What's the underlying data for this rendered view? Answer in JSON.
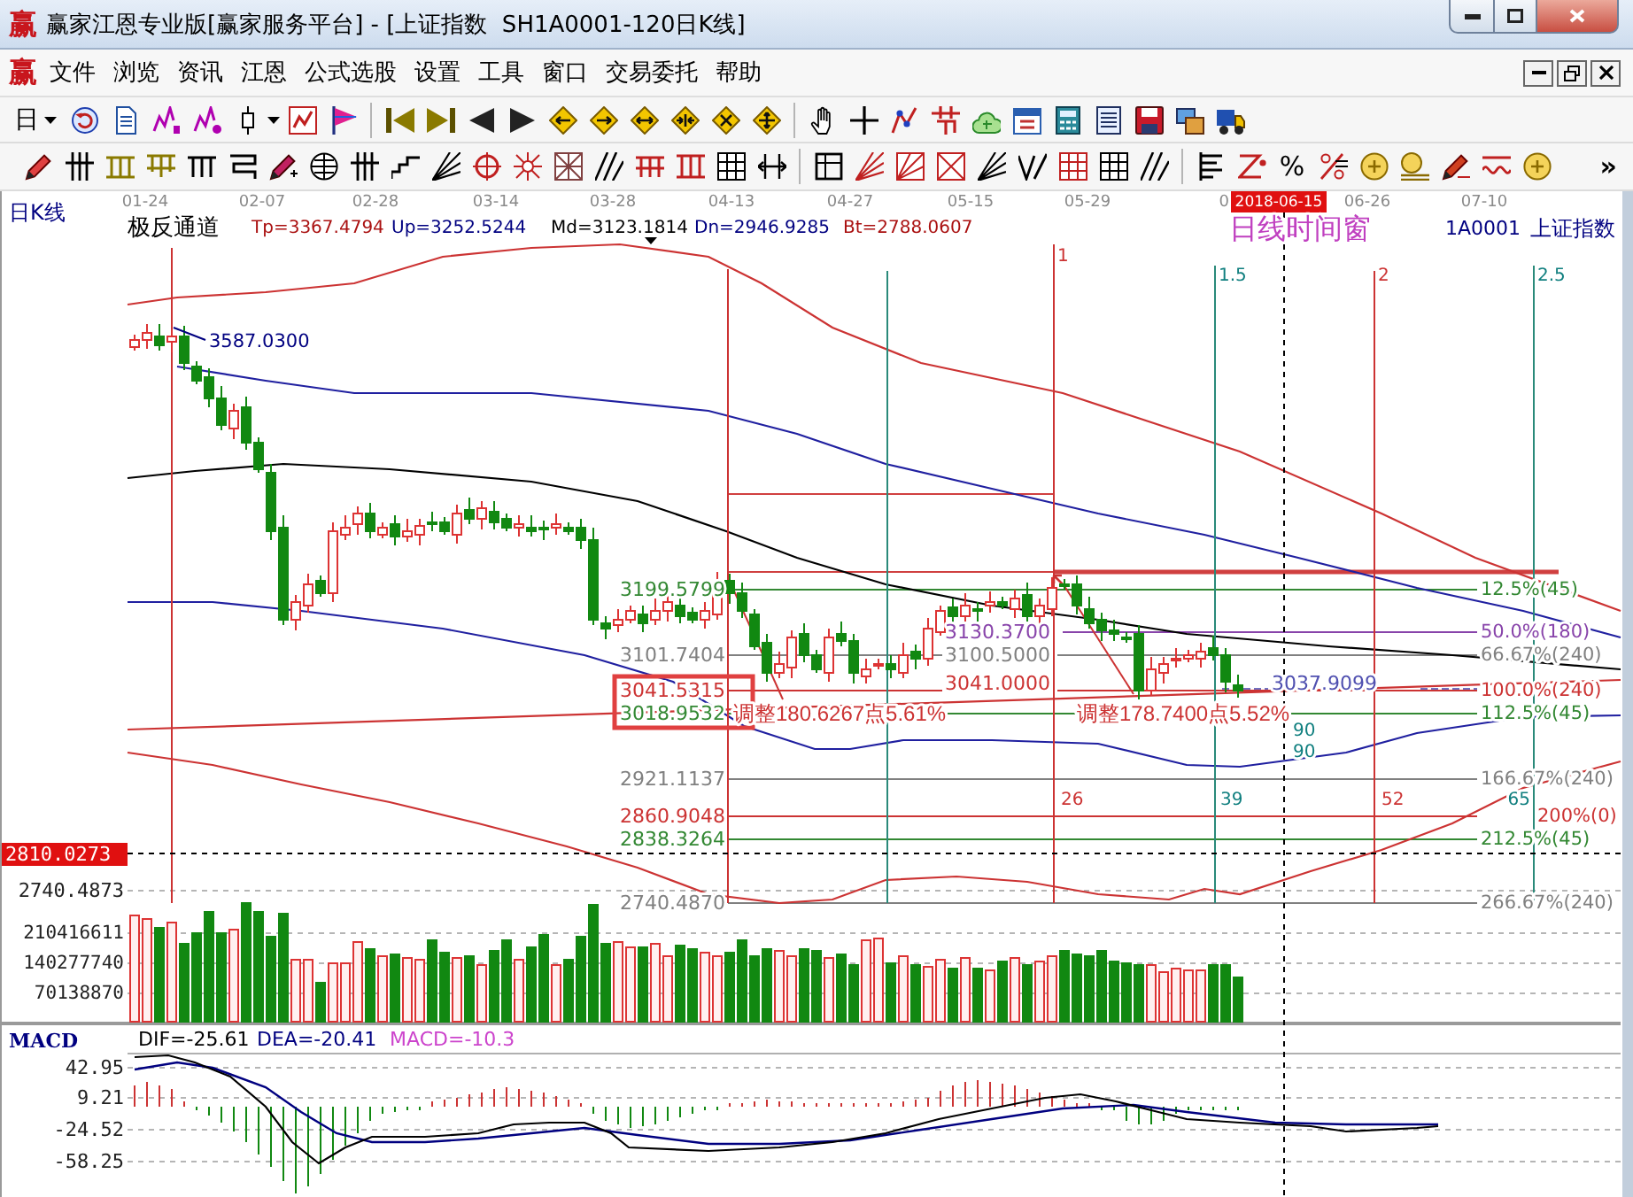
{
  "window": {
    "icon": "赢",
    "title": "赢家江恩专业版[赢家服务平台] - [上证指数  SH1A0001-120日K线]"
  },
  "menu": {
    "icon": "赢",
    "items": [
      "文件",
      "浏览",
      "资讯",
      "江恩",
      "公式选股",
      "设置",
      "工具",
      "窗口",
      "交易委托",
      "帮助"
    ]
  },
  "toolbar": {
    "period": "日",
    "percent": "%",
    "overflow": "»"
  },
  "chart": {
    "period": "日K线",
    "dates": [
      {
        "label": "01-24",
        "kind": "tick"
      },
      {
        "label": "02-07",
        "kind": "tick"
      },
      {
        "label": "02-28",
        "kind": "tick"
      },
      {
        "label": "03-14",
        "kind": "tick"
      },
      {
        "label": "03-28",
        "kind": "tick"
      },
      {
        "label": "04-13",
        "kind": "tick"
      },
      {
        "label": "04-27",
        "kind": "tick"
      },
      {
        "label": "05-15",
        "kind": "tick"
      },
      {
        "label": "05-29",
        "kind": "tick"
      },
      {
        "label": "0",
        "kind": "tick"
      },
      {
        "label": "2018-06-15",
        "kind": "cursor"
      },
      {
        "label": "06-26",
        "kind": "tick"
      },
      {
        "label": "07-10",
        "kind": "tick"
      }
    ],
    "indicator": {
      "name": "极反通道",
      "values": [
        {
          "text": "Tp=3367.4794",
          "color": "#aa1111"
        },
        {
          "text": "Up=3252.5244",
          "color": "#000080"
        },
        {
          "text": "Md=3123.1814",
          "color": "#000000"
        },
        {
          "text": "Dn=2946.9285",
          "color": "#000080"
        },
        {
          "text": "Bt=2788.0607",
          "color": "#aa1111"
        }
      ]
    },
    "window_label": "日线时间窗",
    "code": "1A0001",
    "name": "上证指数",
    "peak_price": "3587.0300",
    "time_marks": [
      {
        "label": "1",
        "color": "#cc3333"
      },
      {
        "label": "1.5",
        "color": "#107f7f"
      },
      {
        "label": "2",
        "color": "#cc3333"
      },
      {
        "label": "2.5",
        "color": "#107f7f"
      }
    ],
    "level_prices": [
      {
        "text": "3199.5799",
        "color": "#338833"
      },
      {
        "text": "3101.7404",
        "color": "#808080"
      },
      {
        "text": "3041.5315",
        "color": "#cc3333"
      },
      {
        "text": "3018.9532",
        "color": "#338833"
      },
      {
        "text": "2921.1137",
        "color": "#808080"
      },
      {
        "text": "2860.9048",
        "color": "#cc3333"
      },
      {
        "text": "2838.3264",
        "color": "#338833"
      },
      {
        "text": "2740.4870",
        "color": "#808080"
      }
    ],
    "swing_prices": [
      {
        "text": "3130.3700",
        "color": "#8844aa"
      },
      {
        "text": "3100.5000",
        "color": "#808080"
      },
      {
        "text": "3041.0000",
        "color": "#cc3333"
      }
    ],
    "level_percents": [
      {
        "text": "12.5%(45)",
        "color": "#338833"
      },
      {
        "text": "50.0%(180)",
        "color": "#8844aa"
      },
      {
        "text": "66.67%(240)",
        "color": "#808080"
      },
      {
        "text": "100.0%(240)",
        "color": "#cc3333"
      },
      {
        "text": "112.5%(45)",
        "color": "#338833"
      },
      {
        "text": "166.67%(240)",
        "color": "#808080"
      },
      {
        "text": "200%(0)",
        "color": "#cc3333"
      },
      {
        "text": "212.5%(45)",
        "color": "#338833"
      },
      {
        "text": "266.67%(240)",
        "color": "#808080"
      }
    ],
    "adjustments": [
      "调整180.6267点5.61%",
      "调整178.7400点5.52%"
    ],
    "bar_counts": [
      {
        "label": "90",
        "color": "#107f7f"
      },
      {
        "label": "90",
        "color": "#107f7f"
      },
      {
        "label": "26",
        "color": "#cc3333"
      },
      {
        "label": "39",
        "color": "#107f7f"
      },
      {
        "label": "52",
        "color": "#cc3333"
      },
      {
        "label": "65",
        "color": "#107f7f"
      }
    ],
    "cursor_price": "3037.9099",
    "axis": [
      {
        "label": "2810.0273",
        "kind": "cursor"
      },
      {
        "label": "2740.4873",
        "kind": "tick"
      }
    ]
  },
  "volume": {
    "axis": [
      "210416611",
      "140277740",
      "70138870"
    ]
  },
  "macd": {
    "name": "MACD",
    "values": [
      {
        "text": "DIF=-25.61",
        "color": "#000000"
      },
      {
        "text": "DEA=-20.41",
        "color": "#000080"
      },
      {
        "text": "MACD=-10.3",
        "color": "#cc44cc"
      }
    ],
    "axis": [
      "42.95",
      "9.21",
      "-24.52",
      "-58.25"
    ]
  }
}
